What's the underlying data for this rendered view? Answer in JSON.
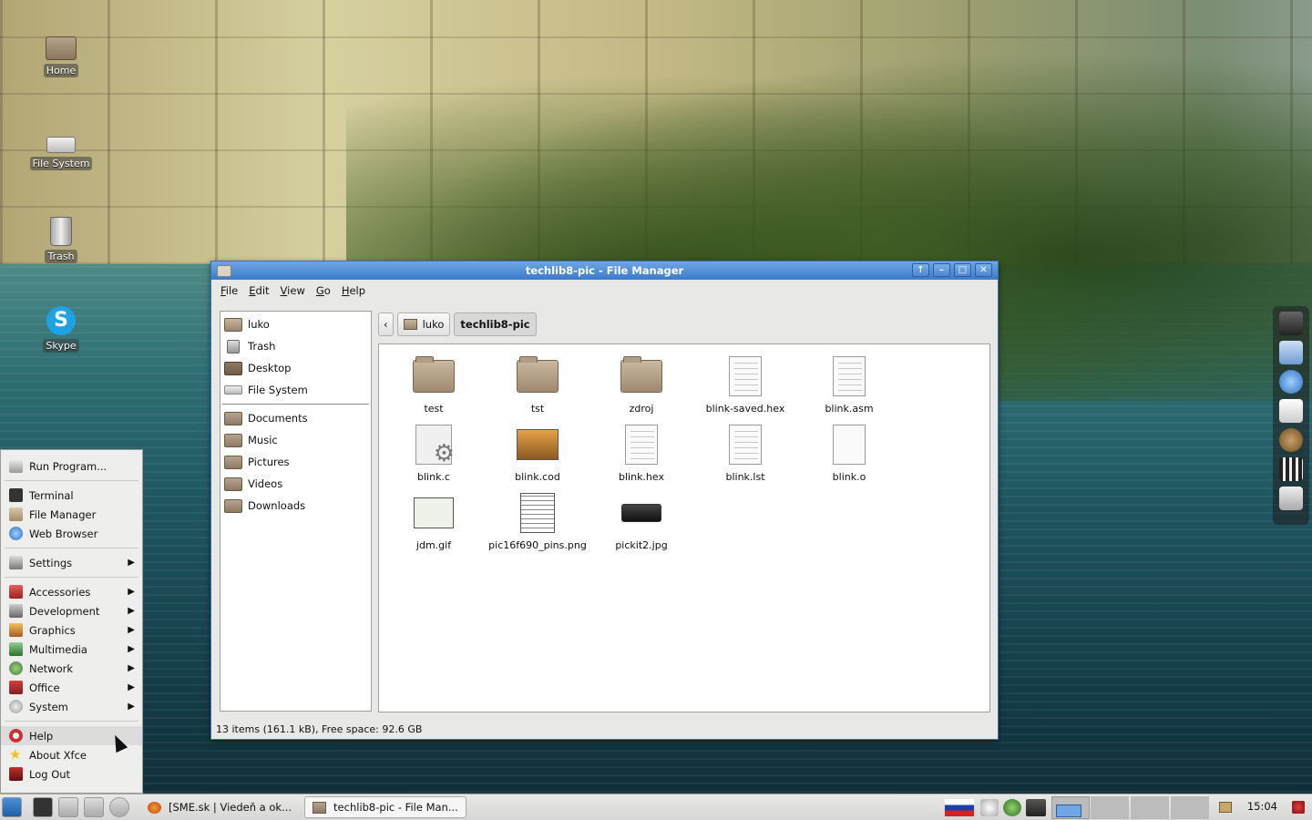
{
  "desktop": {
    "icons": [
      {
        "label": "Home"
      },
      {
        "label": "File System"
      },
      {
        "label": "Trash"
      },
      {
        "label": "Skype"
      }
    ]
  },
  "window": {
    "title": "techlib8-pic - File Manager",
    "menu": [
      "File",
      "Edit",
      "View",
      "Go",
      "Help"
    ],
    "sidebar": {
      "places": [
        "luko",
        "Trash",
        "Desktop",
        "File System"
      ],
      "bookmarks": [
        "Documents",
        "Music",
        "Pictures",
        "Videos",
        "Downloads"
      ]
    },
    "path": [
      "luko",
      "techlib8-pic"
    ],
    "files": [
      {
        "name": "test",
        "icon": "folder-icon"
      },
      {
        "name": "tst",
        "icon": "folder-icon"
      },
      {
        "name": "zdroj",
        "icon": "folder-icon"
      },
      {
        "name": "blink-saved.hex",
        "icon": "text-file-icon"
      },
      {
        "name": "blink.asm",
        "icon": "text-file-icon"
      },
      {
        "name": "blink.c",
        "icon": "source-file-icon"
      },
      {
        "name": "blink.cod",
        "icon": "image-preview-icon"
      },
      {
        "name": "blink.hex",
        "icon": "text-file-icon"
      },
      {
        "name": "blink.lst",
        "icon": "text-file-icon"
      },
      {
        "name": "blink.o",
        "icon": "blank-file-icon"
      },
      {
        "name": "jdm.gif",
        "icon": "image-thumbnail-icon"
      },
      {
        "name": "pic16f690_pins.png",
        "icon": "image-thumbnail-icon"
      },
      {
        "name": "pickit2.jpg",
        "icon": "image-thumbnail-icon"
      }
    ],
    "status": "13 items (161.1 kB), Free space: 92.6 GB"
  },
  "startmenu": {
    "run": "Run Program...",
    "apps": [
      "Terminal",
      "File Manager",
      "Web Browser"
    ],
    "settings": "Settings",
    "categories": [
      "Accessories",
      "Development",
      "Graphics",
      "Multimedia",
      "Network",
      "Office",
      "System"
    ],
    "bottom": [
      "Help",
      "About Xfce",
      "Log Out"
    ]
  },
  "taskbar": {
    "tasks": [
      "[SME.sk | Viedeň a ok...",
      "techlib8-pic - File Man..."
    ],
    "clock": "15:04"
  }
}
